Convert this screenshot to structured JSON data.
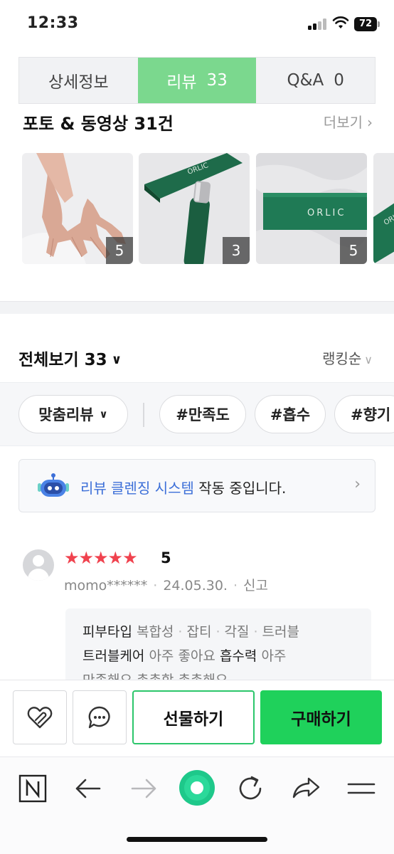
{
  "status": {
    "time": "12:33",
    "battery": "72"
  },
  "tabs": [
    {
      "label": "상세정보",
      "count": ""
    },
    {
      "label": "리뷰",
      "count": "33"
    },
    {
      "label": "Q&A",
      "count": "0"
    }
  ],
  "photos": {
    "title": "포토 & 동영상 31건",
    "more_label": "더보기",
    "thumb_counts": [
      "5",
      "3",
      "5"
    ]
  },
  "review_list": {
    "title": "전체보기 33",
    "sort_label": "랭킹순"
  },
  "filters": {
    "custom_label": "맞춤리뷰",
    "tags": [
      "#만족도",
      "#흡수",
      "#향기"
    ]
  },
  "banner": {
    "highlight": "리뷰 클렌징 시스템",
    "rest": " 작동 중입니다."
  },
  "review": {
    "stars": "★★★★★",
    "score": "5",
    "user": "momo******",
    "date": "24.05.30.",
    "report_label": "신고",
    "attr_line1": {
      "key": "피부타입",
      "values": [
        "복합성",
        "잡티",
        "각질",
        "트러블"
      ]
    },
    "attr_line2": {
      "key1": "트러블케어",
      "val1": "아주 좋아요",
      "key2": "흡수력",
      "val2": "아주"
    },
    "attr_line3_partial": "만족해요  촉촉함  촉촉해요"
  },
  "actions": {
    "gift_label": "선물하기",
    "buy_label": "구매하기"
  },
  "colors": {
    "accent_green": "#1fd15b",
    "tab_active": "#7bd88e",
    "star_red": "#f0424e",
    "link_blue": "#3c6fd8"
  },
  "icons": {
    "like": "heart-clip-icon",
    "chat": "chat-bubble-icon",
    "naver": "n-logo-icon",
    "back": "arrow-left-icon",
    "forward": "arrow-right-icon",
    "home": "green-ring-icon",
    "refresh": "refresh-icon",
    "share": "share-icon",
    "menu": "hamburger-icon"
  }
}
